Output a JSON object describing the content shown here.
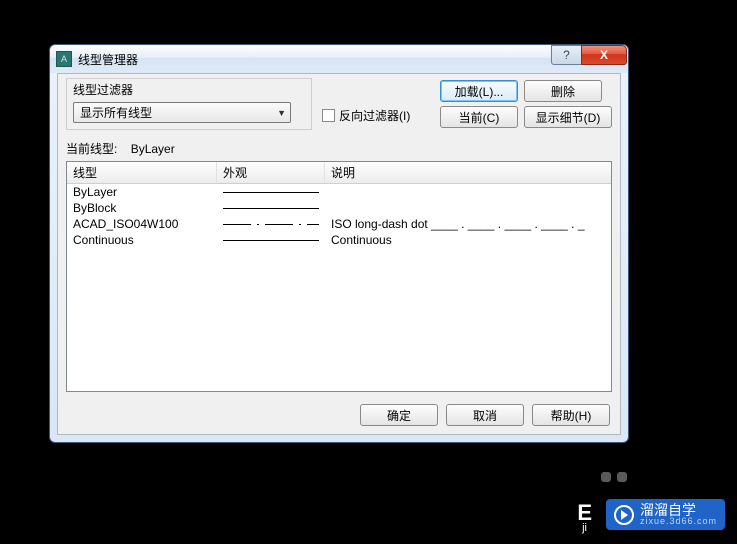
{
  "dialog": {
    "title": "线型管理器",
    "filter_group_label": "线型过滤器",
    "combo_value": "显示所有线型",
    "invert_filter_label": "反向过滤器(I)",
    "buttons": {
      "load": "加载(L)...",
      "delete": "删除",
      "current": "当前(C)",
      "show_details": "显示细节(D)"
    },
    "current_label": "当前线型:",
    "current_value": "ByLayer",
    "columns": {
      "linetype": "线型",
      "appearance": "外观",
      "description": "说明"
    },
    "rows": [
      {
        "name": "ByLayer",
        "style": "solid",
        "desc": ""
      },
      {
        "name": "ByBlock",
        "style": "solid",
        "desc": ""
      },
      {
        "name": "ACAD_ISO04W100",
        "style": "dashdot",
        "desc": "ISO long-dash dot ____ . ____ . ____ . ____ . _"
      },
      {
        "name": "Continuous",
        "style": "solid",
        "desc": "Continuous"
      }
    ],
    "bottom": {
      "ok": "确定",
      "cancel": "取消",
      "help": "帮助(H)"
    }
  },
  "logo": {
    "cn": "溜溜自学",
    "en": "zixue.3d66.com"
  }
}
